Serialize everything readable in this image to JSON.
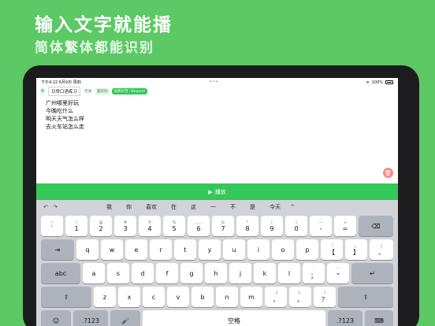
{
  "promo": {
    "headline": "输入文字就能播",
    "subline": "简体繁体都能识别"
  },
  "status": {
    "time_date": "下午4:22  6月9日 周四",
    "dots": "•••",
    "battery": "100%"
  },
  "toolbar": {
    "title": "日常口语练习",
    "tag1": "普通",
    "tag2": "喜欢你",
    "tag3": "光辉岁月 / Beyond"
  },
  "editor": {
    "lines": [
      "广州哪里好玩",
      "今晚吃什么",
      "明天天气怎么样",
      "去火车站怎么走"
    ]
  },
  "play_button": {
    "label": "播放",
    "icon": "play-icon"
  },
  "candidates": {
    "undo": "↶",
    "redo": "↷",
    "words": [
      "我",
      "你",
      "喜欢",
      "在",
      "这",
      "一",
      "不",
      "是",
      "今天"
    ],
    "collapse": "^"
  },
  "keyboard": {
    "row1": [
      {
        "top": "~",
        "main": "`"
      },
      {
        "top": "!",
        "main": "1"
      },
      {
        "top": "@",
        "main": "2"
      },
      {
        "top": "#",
        "main": "3"
      },
      {
        "top": "¥",
        "main": "4"
      },
      {
        "top": "%",
        "main": "5"
      },
      {
        "top": "……",
        "main": "6"
      },
      {
        "top": "&",
        "main": "7"
      },
      {
        "top": "*",
        "main": "8"
      },
      {
        "top": "(",
        "main": "9"
      },
      {
        "top": ")",
        "main": "0"
      },
      {
        "top": "—",
        "main": "-"
      },
      {
        "top": "+",
        "main": "="
      }
    ],
    "delete": "⌫",
    "tab": "⇥",
    "row2": [
      "q",
      "w",
      "e",
      "r",
      "t",
      "y",
      "u",
      "i",
      "o",
      "p"
    ],
    "row2_extra": [
      {
        "top": "「",
        "main": "【"
      },
      {
        "top": "」",
        "main": "】"
      },
      {
        "top": "|",
        "main": "、"
      }
    ],
    "caps": "abc",
    "row3": [
      "a",
      "s",
      "d",
      "f",
      "g",
      "h",
      "j",
      "k",
      "l"
    ],
    "row3_extra": [
      {
        "top": ":",
        "main": "；"
      },
      {
        "top": "“",
        "main": "”"
      }
    ],
    "return": "↵",
    "shift": "⇧",
    "row4": [
      "z",
      "x",
      "c",
      "v",
      "b",
      "n",
      "m"
    ],
    "row4_extra": [
      {
        "top": "《",
        "main": "，"
      },
      {
        "top": "》",
        "main": "。"
      },
      {
        "top": "?",
        "main": "？"
      }
    ],
    "emoji": "☺",
    "num": ".?123",
    "mic": "🎤",
    "space": "空格",
    "hide": "⌨"
  }
}
